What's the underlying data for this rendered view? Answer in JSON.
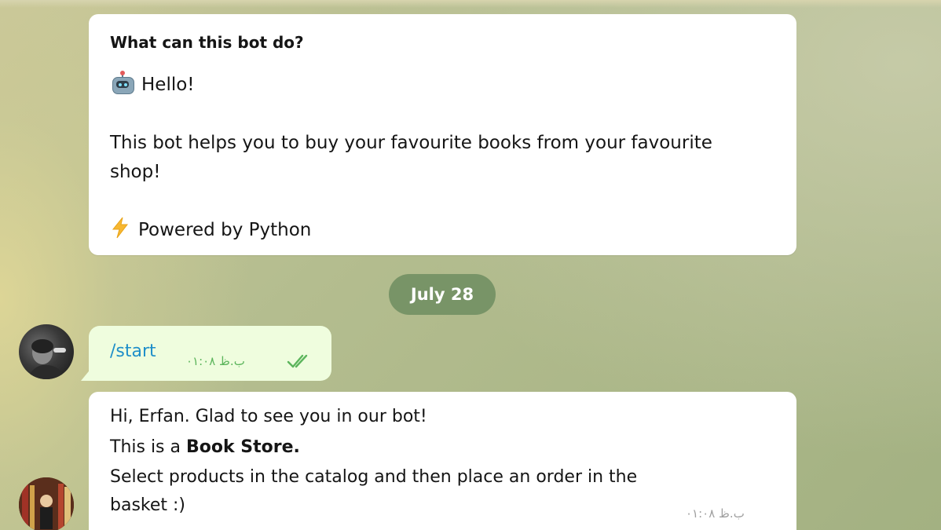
{
  "intro": {
    "title": "What can this bot do?",
    "hello": "Hello!",
    "description_line1": "This bot helps you to buy your favourite books from your favourite",
    "description_line2": "shop!",
    "powered": "Powered by Python",
    "hello_icon": "robot-face",
    "powered_icon": "high-voltage"
  },
  "date_separator": "July 28",
  "outgoing_message": {
    "text": "/start",
    "time": "ب.ظ ۰۱:۰۸",
    "status_icon": "double-check",
    "status_color": "#5cb55c"
  },
  "incoming_message": {
    "line1": "Hi, Erfan. Glad to see you in our bot!",
    "line2_prefix": "This is a ",
    "line2_bold": "Book Store.",
    "line3": "Select products in the catalog and then place an order in the",
    "line4": "basket :)",
    "time": "ب.ظ ۰۱:۰۸"
  },
  "colors": {
    "link": "#1f8fc9",
    "date_pill": "#708e62",
    "outgoing_bubble": "#effdde"
  }
}
